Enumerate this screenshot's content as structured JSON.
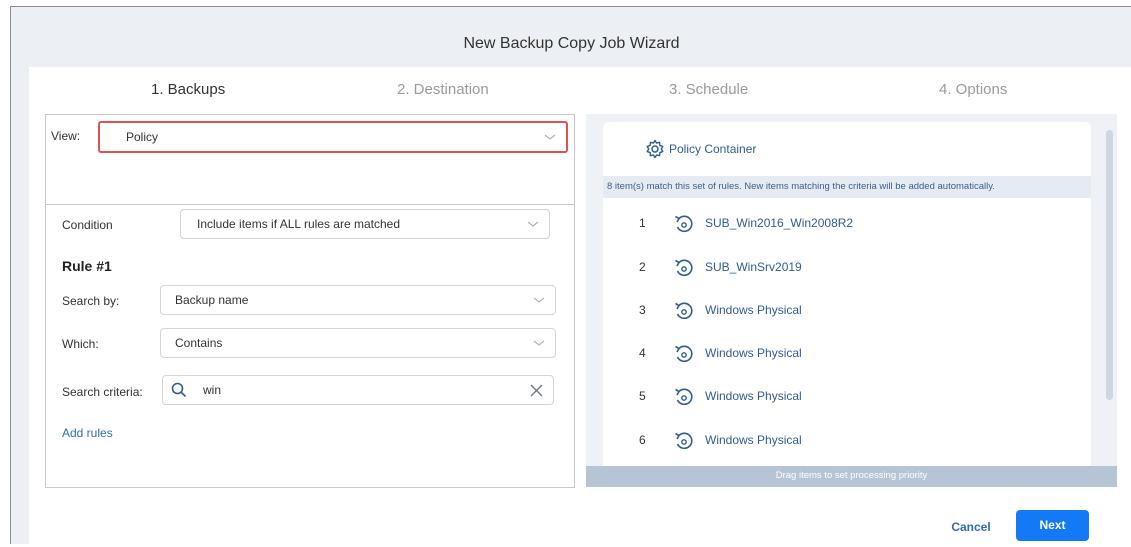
{
  "window": {
    "title": "New Backup Copy Job Wizard"
  },
  "steps": [
    {
      "label": "1. Backups",
      "active": true
    },
    {
      "label": "2. Destination",
      "active": false
    },
    {
      "label": "3. Schedule",
      "active": false
    },
    {
      "label": "4. Options",
      "active": false
    }
  ],
  "view": {
    "label": "View:",
    "value": "Policy"
  },
  "condition": {
    "label": "Condition",
    "value": "Include items if ALL rules are matched"
  },
  "rule": {
    "title": "Rule #1",
    "search_by_label": "Search by:",
    "search_by_value": "Backup name",
    "which_label": "Which:",
    "which_value": "Contains",
    "criteria_label": "Search criteria:",
    "criteria_value": "win"
  },
  "add_rules_label": "Add rules",
  "policy": {
    "container_name": "Policy Container",
    "match_text": "8 item(s) match this set of rules. New items matching the criteria will be added automatically.",
    "items": [
      {
        "num": "1",
        "name": "SUB_Win2016_Win2008R2"
      },
      {
        "num": "2",
        "name": "SUB_WinSrv2019"
      },
      {
        "num": "3",
        "name": "Windows Physical"
      },
      {
        "num": "4",
        "name": "Windows Physical"
      },
      {
        "num": "5",
        "name": "Windows Physical"
      },
      {
        "num": "6",
        "name": "Windows Physical"
      }
    ],
    "drag_hint": "Drag items to set processing priority"
  },
  "buttons": {
    "cancel": "Cancel",
    "next": "Next"
  },
  "colors": {
    "accent": "#1479f5",
    "link": "#2f6db5",
    "highlight_border": "#e05252"
  },
  "icons": {
    "gear": "gear-icon",
    "backup": "backup-restore-icon",
    "search": "search-icon",
    "clear": "close-icon",
    "chevron": "chevron-down-icon"
  }
}
